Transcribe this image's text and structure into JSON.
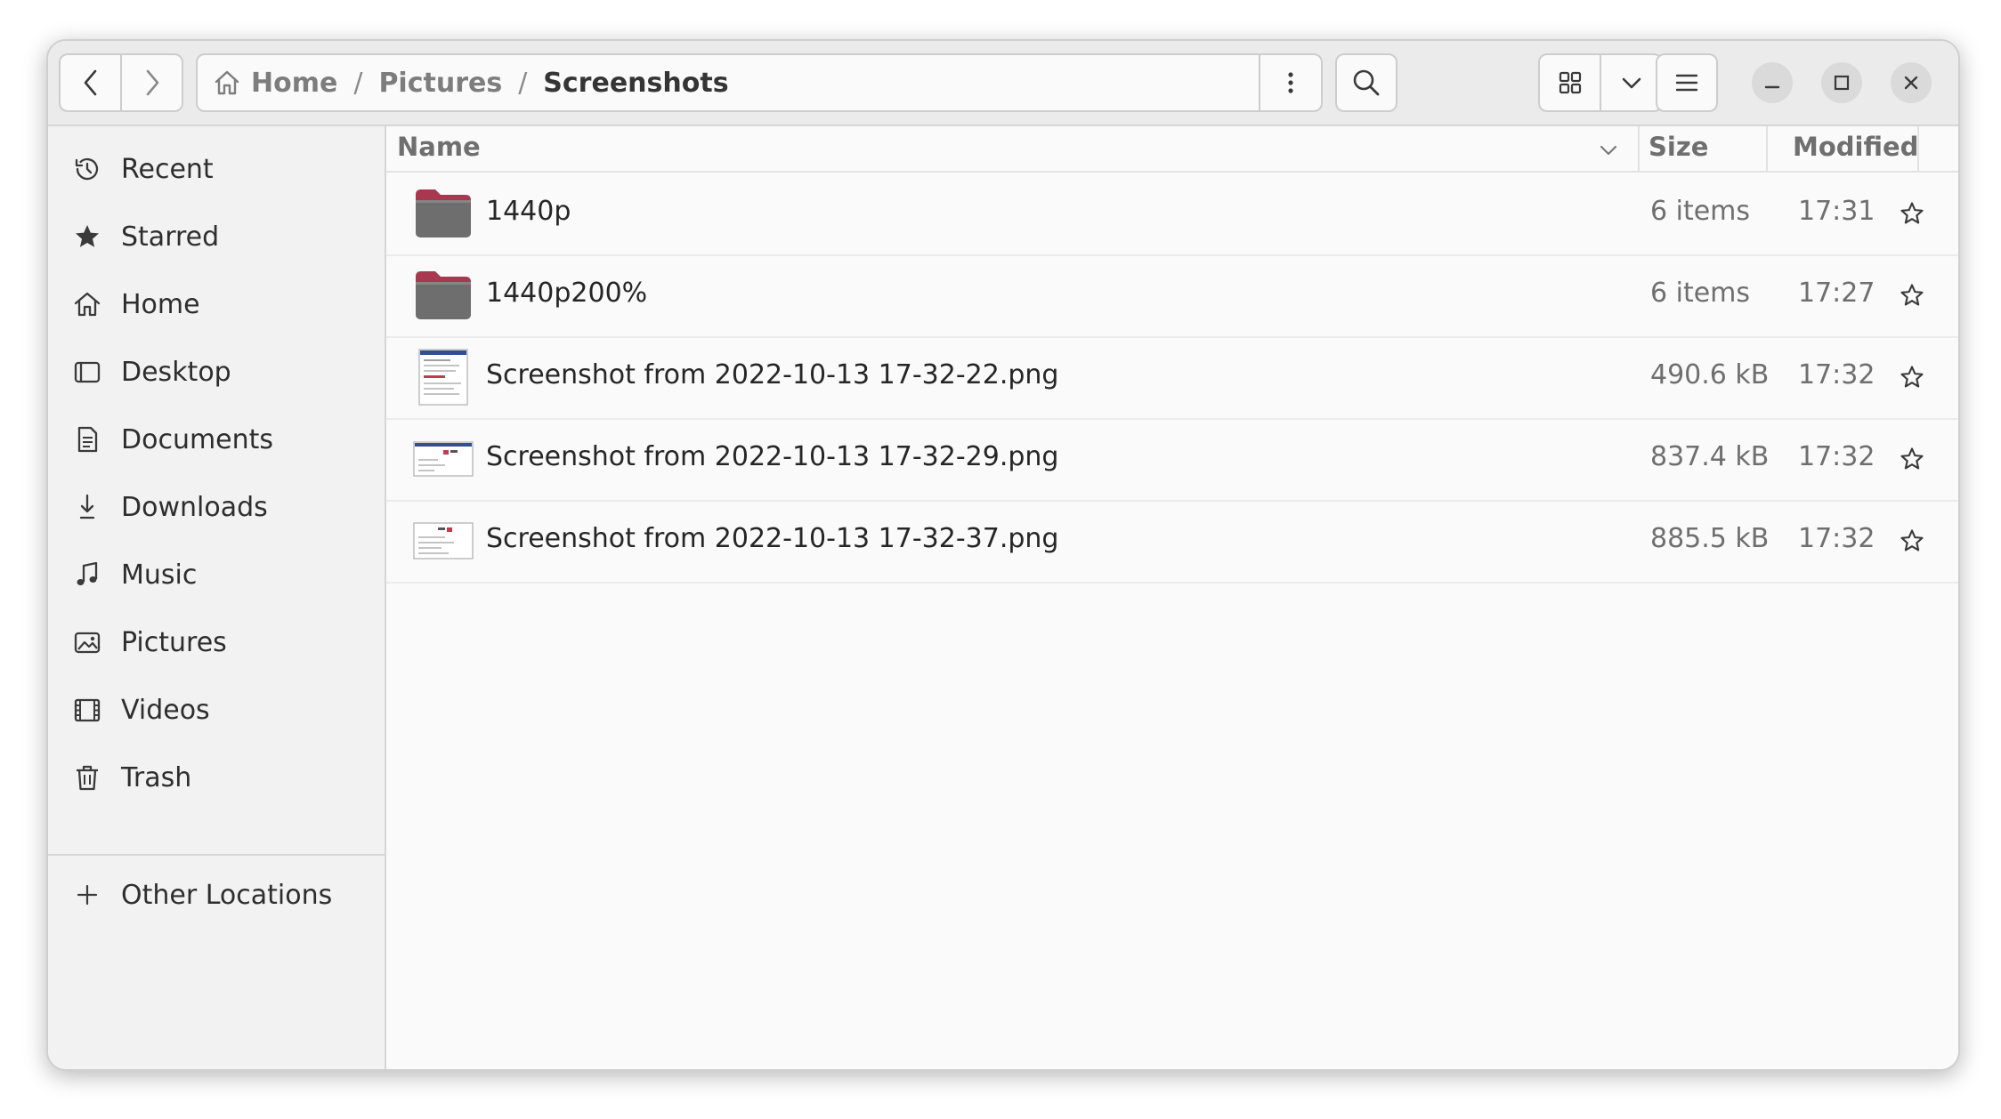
{
  "breadcrumb": {
    "home": "Home",
    "separator": "/",
    "pictures": "Pictures",
    "current": "Screenshots"
  },
  "sidebar": {
    "items": [
      {
        "label": "Recent",
        "icon": "clock-icon"
      },
      {
        "label": "Starred",
        "icon": "star-icon"
      },
      {
        "label": "Home",
        "icon": "home-icon"
      },
      {
        "label": "Desktop",
        "icon": "desktop-icon"
      },
      {
        "label": "Documents",
        "icon": "document-icon"
      },
      {
        "label": "Downloads",
        "icon": "download-icon"
      },
      {
        "label": "Music",
        "icon": "music-icon"
      },
      {
        "label": "Pictures",
        "icon": "image-icon"
      },
      {
        "label": "Videos",
        "icon": "video-icon"
      },
      {
        "label": "Trash",
        "icon": "trash-icon"
      }
    ],
    "other_locations": "Other Locations"
  },
  "columns": {
    "name": "Name",
    "size": "Size",
    "modified": "Modified"
  },
  "files": [
    {
      "name": "1440p",
      "size": "6 items",
      "modified": "17:31",
      "type": "folder"
    },
    {
      "name": "1440p200%",
      "size": "6 items",
      "modified": "17:27",
      "type": "folder"
    },
    {
      "name": "Screenshot from 2022-10-13 17-32-22.png",
      "size": "490.6 kB",
      "modified": "17:32",
      "type": "image"
    },
    {
      "name": "Screenshot from 2022-10-13 17-32-29.png",
      "size": "837.4 kB",
      "modified": "17:32",
      "type": "image"
    },
    {
      "name": "Screenshot from 2022-10-13 17-32-37.png",
      "size": "885.5 kB",
      "modified": "17:32",
      "type": "image"
    }
  ],
  "colors": {
    "folder_tab": "#a8384f",
    "folder_body": "#6e6e6e",
    "accent": "#e95420"
  }
}
